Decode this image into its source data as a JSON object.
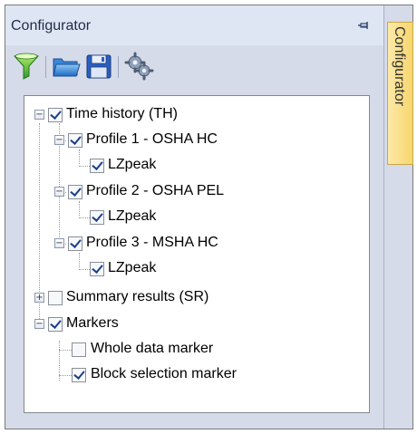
{
  "panel": {
    "title": "Configurator",
    "pin_icon": "pin-icon"
  },
  "side_tab": {
    "label": "Configurator"
  },
  "toolbar": {
    "buttons": [
      {
        "name": "filter-button",
        "icon": "filter-icon"
      },
      {
        "name": "open-button",
        "icon": "folder-open-icon"
      },
      {
        "name": "save-button",
        "icon": "save-icon"
      },
      {
        "name": "settings-button",
        "icon": "gears-icon"
      }
    ]
  },
  "tree": {
    "time_history": {
      "label": "Time history (TH)",
      "checked": true,
      "expanded": true,
      "profile1": {
        "label": "Profile 1 - OSHA HC",
        "checked": true,
        "child": "LZpeak"
      },
      "profile2": {
        "label": "Profile 2 - OSHA PEL",
        "checked": true,
        "child": "LZpeak"
      },
      "profile3": {
        "label": "Profile 3 - MSHA HC",
        "checked": true,
        "child": "LZpeak"
      }
    },
    "summary_results": {
      "label": "Summary results (SR)",
      "checked": false,
      "expanded": false
    },
    "markers": {
      "label": "Markers",
      "checked": true,
      "expanded": true,
      "whole_data": {
        "label": "Whole data marker",
        "checked": false
      },
      "block_selection": {
        "label": "Block selection marker",
        "checked": true
      }
    }
  },
  "colors": {
    "panel_bg": "#d6dbe9",
    "header_bg": "#dfe6f3",
    "tab_bg": "#f7d66f",
    "check_color": "#1a3f8a"
  }
}
